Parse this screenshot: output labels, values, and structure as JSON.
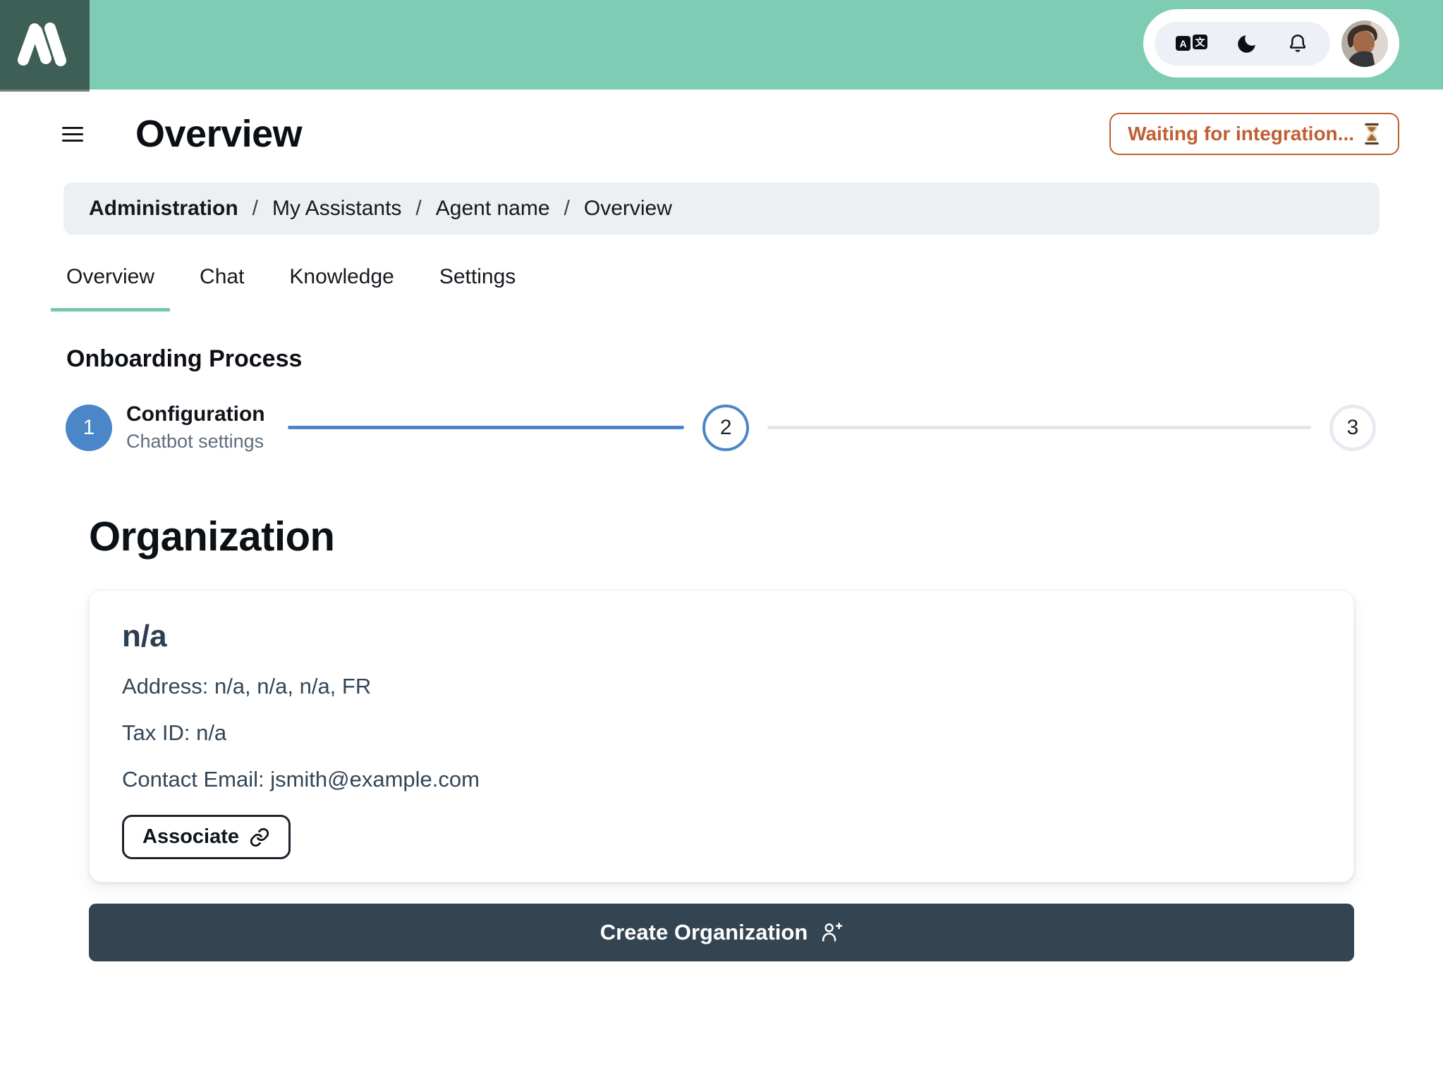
{
  "header": {
    "logo_name": "alma-logo",
    "actions": {
      "language_icon": "translate-icon",
      "dark_mode_icon": "moon-icon",
      "notifications_icon": "bell-icon",
      "avatar_icon": "user-avatar"
    }
  },
  "icons": {
    "translate": [
      "A",
      "文"
    ],
    "status": "hourglass-icon",
    "associate": "link-icon",
    "create": "person-plus-icon",
    "menu": "hamburger-icon"
  },
  "page": {
    "title": "Overview",
    "status_label": "Waiting for integration..."
  },
  "breadcrumb": {
    "separator": "/",
    "items": [
      "Administration",
      "My Assistants",
      "Agent name",
      "Overview"
    ]
  },
  "tabs": [
    {
      "label": "Overview",
      "active": true
    },
    {
      "label": "Chat",
      "active": false
    },
    {
      "label": "Knowledge",
      "active": false
    },
    {
      "label": "Settings",
      "active": false
    }
  ],
  "onboarding": {
    "heading": "Onboarding Process",
    "steps": [
      {
        "number": "1",
        "title": "Configuration",
        "subtitle": "Chatbot settings",
        "state": "current"
      },
      {
        "number": "2",
        "state": "next"
      },
      {
        "number": "3",
        "state": "upcoming"
      }
    ]
  },
  "organization": {
    "heading": "Organization",
    "card": {
      "name": "n/a",
      "lines": [
        "Address: n/a, n/a, n/a, FR",
        "Tax ID: n/a",
        "Contact Email: jsmith@example.com"
      ],
      "associate_label": "Associate"
    },
    "create_label": "Create Organization"
  },
  "colors": {
    "header_green": "#7fccb4",
    "logo_dark_green": "#3e5f55",
    "status_orange": "#bf5f33",
    "step_blue": "#4a86c8",
    "tab_underline_green": "#79c8a9",
    "connector_gray": "#e2e7ee",
    "dark_button": "#334452",
    "breadcrumb_bg": "#edf0f3",
    "card_text": "#334658"
  }
}
